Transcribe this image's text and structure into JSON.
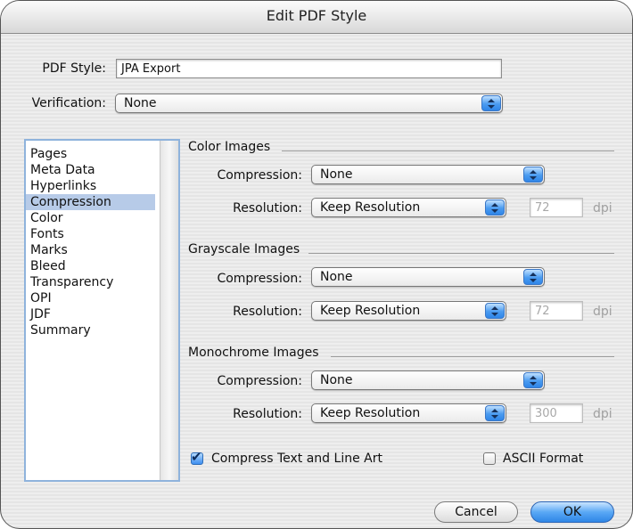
{
  "window": {
    "title": "Edit PDF Style"
  },
  "pdf_style": {
    "label": "PDF Style:",
    "value": "JPA Export"
  },
  "verification": {
    "label": "Verification:",
    "value": "None"
  },
  "sidebar": {
    "items": [
      {
        "label": "Pages"
      },
      {
        "label": "Meta Data"
      },
      {
        "label": "Hyperlinks"
      },
      {
        "label": "Compression",
        "selected": true
      },
      {
        "label": "Color"
      },
      {
        "label": "Fonts"
      },
      {
        "label": "Marks"
      },
      {
        "label": "Bleed"
      },
      {
        "label": "Transparency"
      },
      {
        "label": "OPI"
      },
      {
        "label": "JDF"
      },
      {
        "label": "Summary"
      }
    ]
  },
  "groups": {
    "color": {
      "title": "Color Images",
      "compression_label": "Compression:",
      "compression_value": "None",
      "resolution_label": "Resolution:",
      "resolution_value": "Keep Resolution",
      "dpi_value": "72",
      "dpi_unit": "dpi"
    },
    "grayscale": {
      "title": "Grayscale Images",
      "compression_label": "Compression:",
      "compression_value": "None",
      "resolution_label": "Resolution:",
      "resolution_value": "Keep Resolution",
      "dpi_value": "72",
      "dpi_unit": "dpi"
    },
    "monochrome": {
      "title": "Monochrome Images",
      "compression_label": "Compression:",
      "compression_value": "None",
      "resolution_label": "Resolution:",
      "resolution_value": "Keep Resolution",
      "dpi_value": "300",
      "dpi_unit": "dpi"
    }
  },
  "options": {
    "compress_text": {
      "label": "Compress Text and Line Art",
      "checked": true
    },
    "ascii_format": {
      "label": "ASCII Format",
      "checked": false
    }
  },
  "buttons": {
    "cancel": "Cancel",
    "ok": "OK"
  },
  "icons": {
    "popup_arrows": "up-down-arrows-icon",
    "checkmark": "checkmark-icon",
    "scroll": "scrollbar-track"
  },
  "colors": {
    "accent": "#3d8ef0",
    "selection": "#b7cbe8"
  }
}
